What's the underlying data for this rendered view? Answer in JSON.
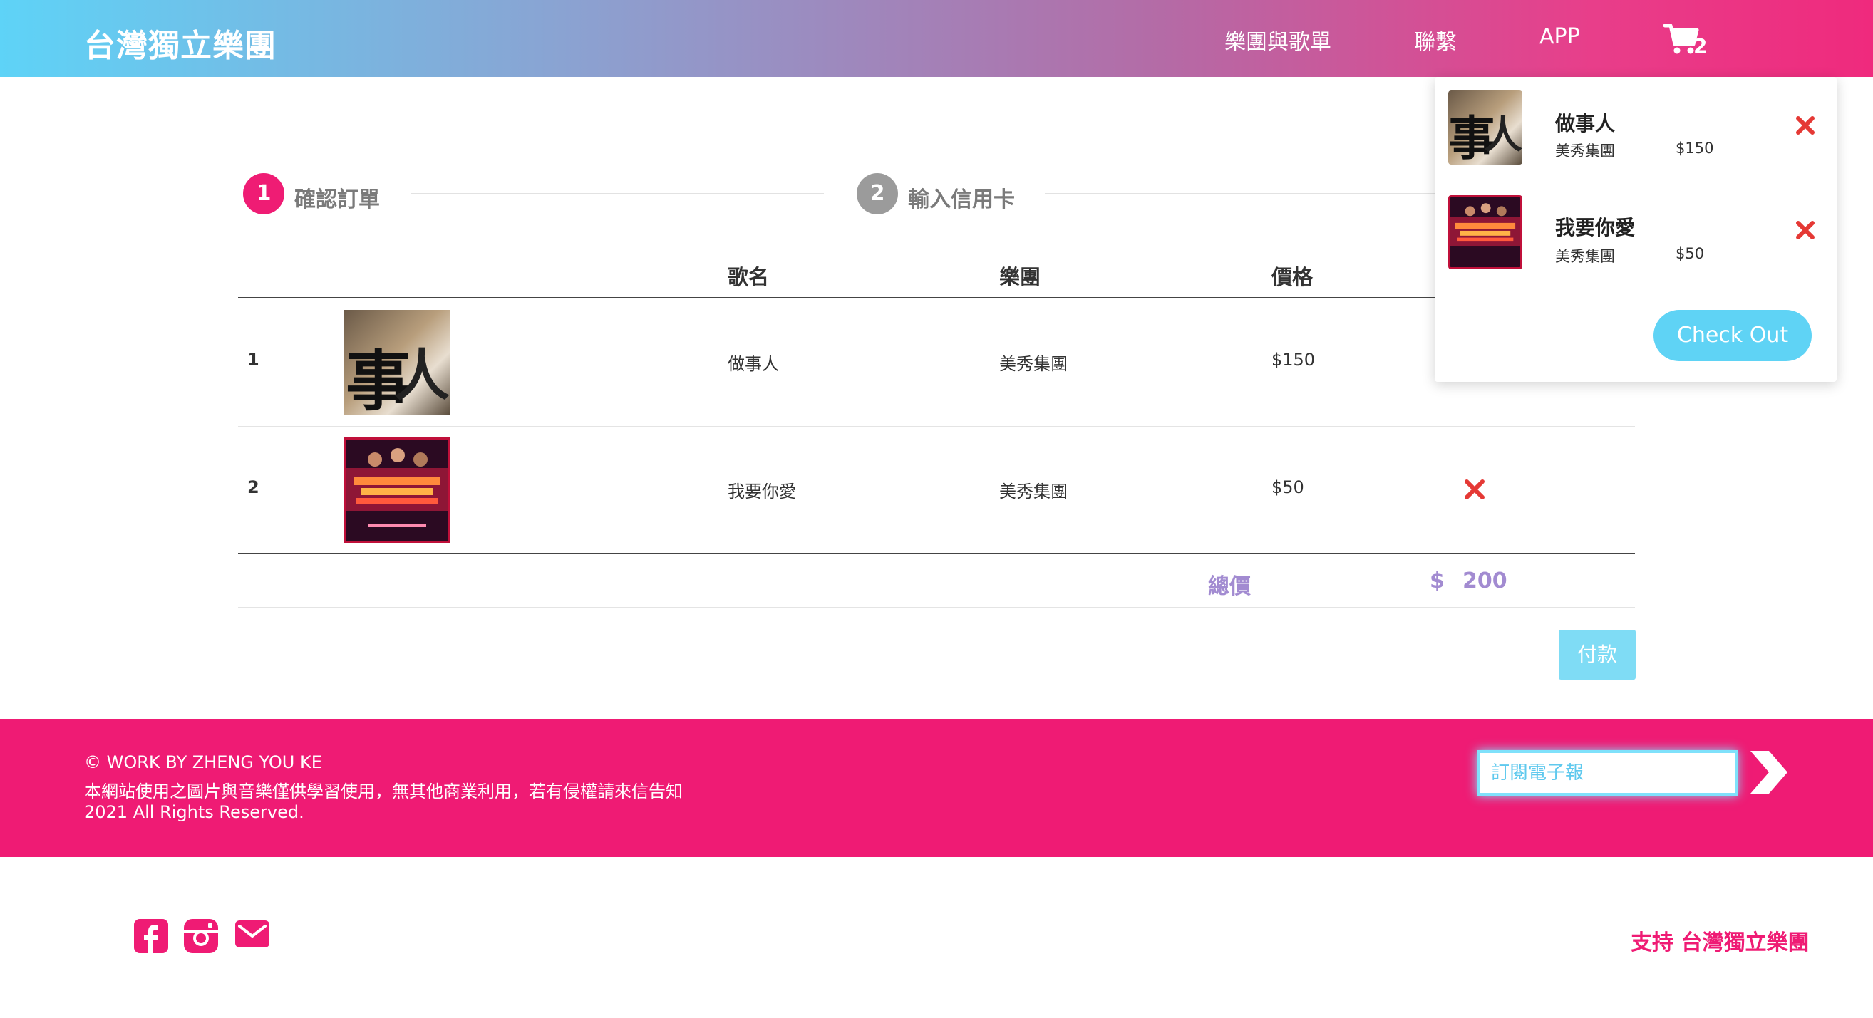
{
  "header": {
    "brand": "台灣獨立樂團",
    "nav": {
      "bands": "樂團與歌單",
      "contact": "聯繫",
      "app": "APP"
    },
    "cart_count": "2"
  },
  "steps": [
    {
      "number": "1",
      "label": "確認訂單"
    },
    {
      "number": "2",
      "label": "輸入信用卡"
    }
  ],
  "table": {
    "headers": {
      "song": "歌名",
      "band": "樂團",
      "price": "價格"
    },
    "rows": [
      {
        "index": "1",
        "song": "做事人",
        "band": "美秀集團",
        "price": "$150"
      },
      {
        "index": "2",
        "song": "我要你愛",
        "band": "美秀集團",
        "price": "$50"
      }
    ],
    "total_label": "總價",
    "total_currency": "$",
    "total_value": "200",
    "pay_label": "付款"
  },
  "dropdown": {
    "items": [
      {
        "title": "做事人",
        "band": "美秀集團",
        "price": "$150"
      },
      {
        "title": "我要你愛",
        "band": "美秀集團",
        "price": "$50"
      }
    ],
    "checkout_label": "Check Out"
  },
  "footer": {
    "line1": "© WORK BY ZHENG YOU KE",
    "line2": "本網站使用之圖片與音樂僅供學習使用，無其他商業利用，若有侵權請來信告知",
    "line3": "2021 All Rights Reserved.",
    "subscribe_placeholder": "訂閱電子報"
  },
  "bottom": {
    "social_icons": [
      "facebook-icon",
      "instagram-icon",
      "mail-icon"
    ],
    "support_text": "支持 台灣獨立樂團"
  },
  "colors": {
    "accent_pink": "#ef1b74",
    "accent_cyan": "#5fd3f5",
    "total_purple": "#a28bd1",
    "remove_red": "#e53935"
  }
}
